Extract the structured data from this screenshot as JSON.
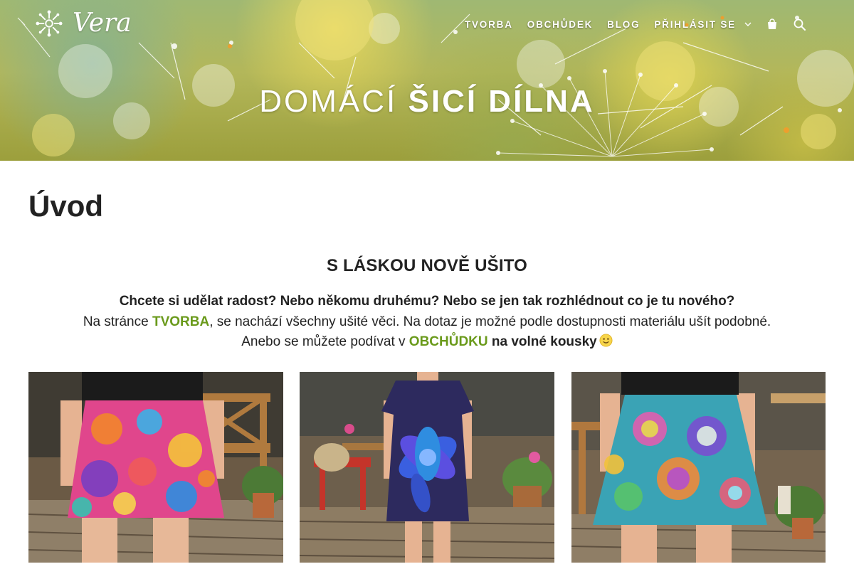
{
  "brand": {
    "logo_text": "Vera",
    "logo_icon": "snowflake-flower-icon"
  },
  "nav": {
    "items": [
      {
        "label": "TVORBA"
      },
      {
        "label": "OBCHŮDEK"
      },
      {
        "label": "BLOG"
      },
      {
        "label": "PŘIHLÁSIT SE"
      }
    ],
    "icons": [
      "chevron-down-icon",
      "shopping-bag-icon",
      "search-icon"
    ]
  },
  "hero": {
    "title_light": "DOMÁCÍ",
    "title_bold": "ŠICÍ DÍLNA"
  },
  "page": {
    "title": "Úvod"
  },
  "content": {
    "heading": "S LÁSKOU NOVĚ UŠITO",
    "line1": "Chcete si udělat radost? Nebo někomu druhému? Nebo se jen tak rozhlédnout co je tu nového?",
    "line2_prefix": "Na stránce ",
    "line2_link": "TVORBA",
    "line2_suffix": ", se nachází všechny ušité věci. Na dotaz je možné podle dostupnosti materiálu ušít podobné.",
    "line3_prefix": "Anebo se můžete podívat v ",
    "line3_link": "OBCHŮDKU",
    "line3_suffix": " na volné kousky",
    "link_color": "#6a9a1b"
  },
  "colors": {
    "text": "#222222",
    "accent_green": "#6a9a1b",
    "hero_yellow": "#c9c45a"
  }
}
